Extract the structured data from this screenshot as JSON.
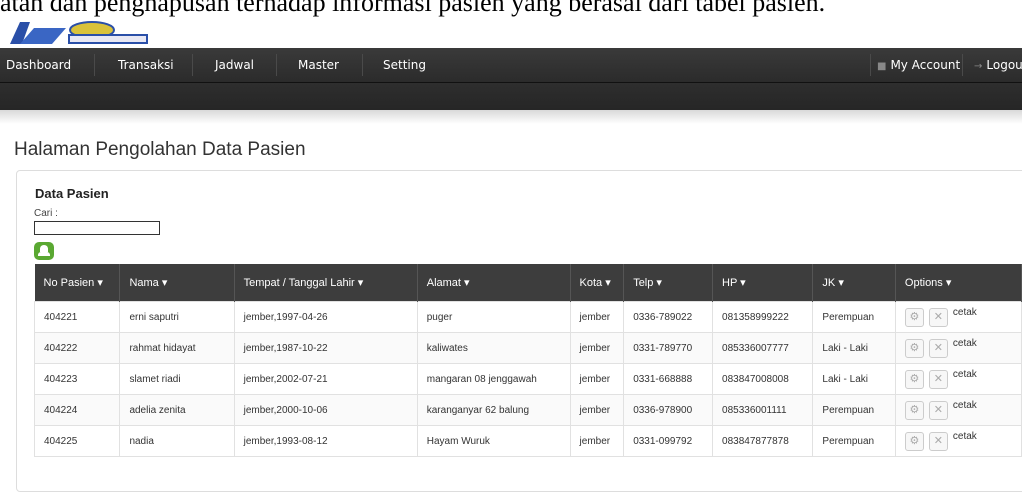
{
  "doc_text": "atan dan penghapusan terhadap informasi pasien yang berasal dari tabel pasien.",
  "nav": {
    "items": [
      "Dashboard",
      "Transaksi",
      "Jadwal",
      "Master",
      "Setting"
    ],
    "my_account": "My Account",
    "logout": "Logout"
  },
  "page_title": "Halaman Pengolahan Data Pasien",
  "card_title": "Data Pasien",
  "search": {
    "label": "Cari :",
    "value": ""
  },
  "table": {
    "headers": [
      "No Pasien",
      "Nama",
      "Tempat / Tanggal Lahir",
      "Alamat",
      "Kota",
      "Telp",
      "HP",
      "JK",
      "Options"
    ],
    "rows": [
      [
        "404221",
        "erni saputri",
        "jember,1997-04-26",
        "puger",
        "jember",
        "0336-789022",
        "081358999222",
        "Perempuan"
      ],
      [
        "404222",
        "rahmat hidayat",
        "jember,1987-10-22",
        "kaliwates",
        "jember",
        "0331-789770",
        "085336007777",
        "Laki - Laki"
      ],
      [
        "404223",
        "slamet riadi",
        "jember,2002-07-21",
        "mangaran 08 jenggawah",
        "jember",
        "0331-668888",
        "083847008008",
        "Laki - Laki"
      ],
      [
        "404224",
        "adelia zenita",
        "jember,2000-10-06",
        "karanganyar 62 balung",
        "jember",
        "0336-978900",
        "085336001111",
        "Perempuan"
      ],
      [
        "404225",
        "nadia",
        "jember,1993-08-12",
        "Hayam Wuruk",
        "jember",
        "0331-099792",
        "083847877878",
        "Perempuan"
      ]
    ],
    "action_label": "cetak"
  },
  "icons": {
    "edit": "gear-icon",
    "delete": "close-icon",
    "add": "add-user-icon"
  }
}
